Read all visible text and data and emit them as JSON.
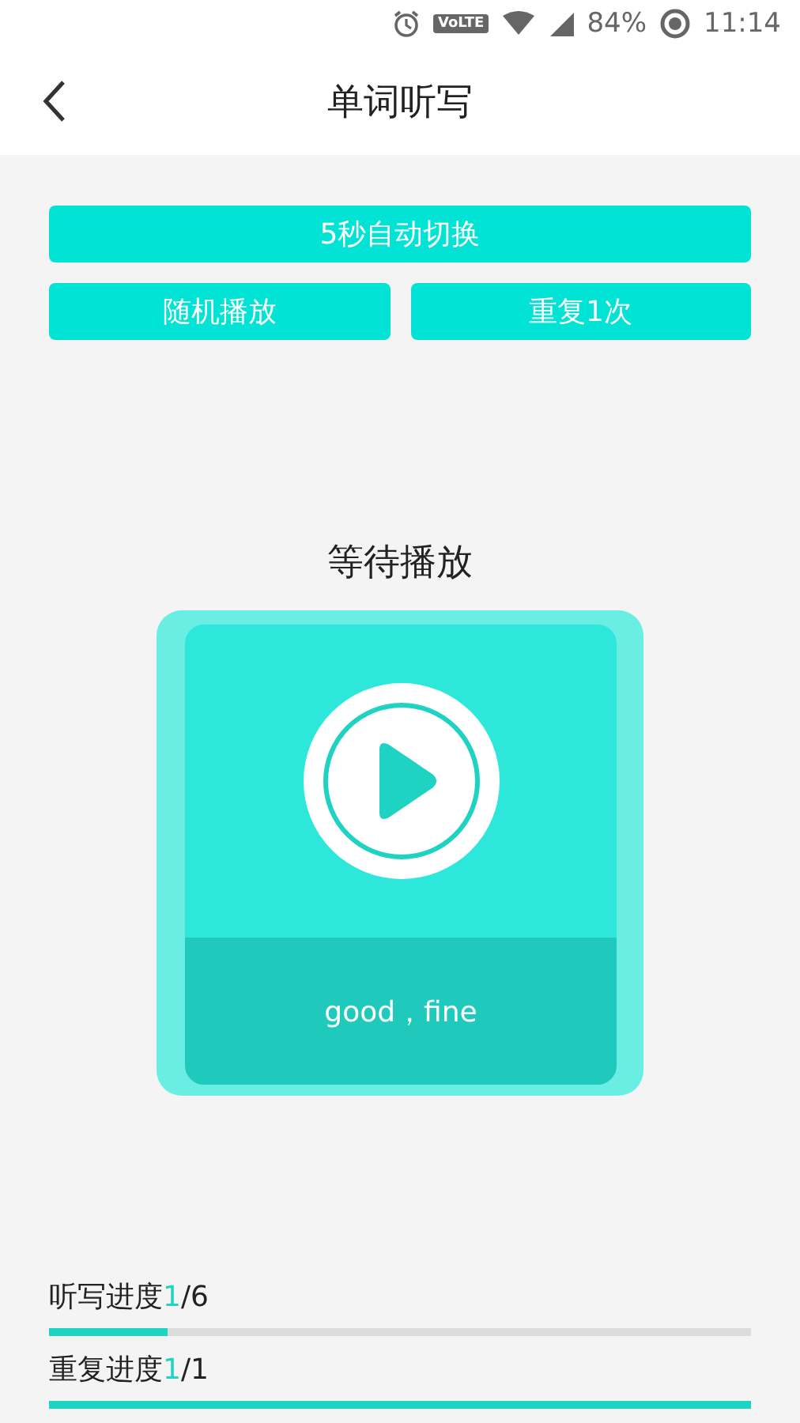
{
  "status_bar": {
    "volte": "VoLTE",
    "battery": "84%",
    "time": "11:14"
  },
  "header": {
    "title": "单词听写"
  },
  "options": {
    "auto_switch": "5秒自动切换",
    "random": "随机播放",
    "repeat": "重复1次"
  },
  "player": {
    "status": "等待播放",
    "word": "good，fine"
  },
  "progress": [
    {
      "label": "听写进度",
      "current": "1",
      "total": "/6",
      "level": 0.17
    },
    {
      "label": "重复进度",
      "current": "1",
      "total": "/1",
      "level": 1.0
    }
  ]
}
